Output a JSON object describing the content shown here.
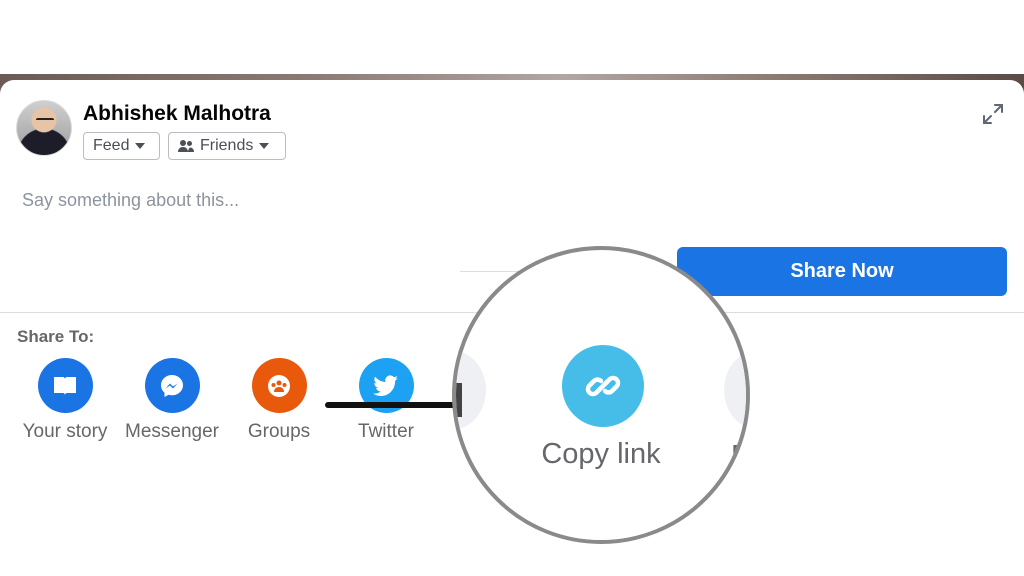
{
  "post": {
    "user_name": "Abhishek Malhotra",
    "audience_feed": "Feed",
    "audience_friends": "Friends",
    "composer_placeholder": "Say something about this...",
    "share_now_label": "Share Now"
  },
  "share_to": {
    "heading": "Share To:",
    "targets": [
      {
        "label": "Your story",
        "color": "#1b74e4",
        "icon": "book-icon"
      },
      {
        "label": "Messenger",
        "color": "#1b74e4",
        "icon": "messenger-icon"
      },
      {
        "label": "Groups",
        "color": "#e8590c",
        "icon": "groups-icon"
      },
      {
        "label": "Twitter",
        "color": "#1da1f2",
        "icon": "twitter-icon"
      }
    ]
  },
  "magnified": {
    "copy_link_label": "Copy link",
    "copy_link_color": "#45bde8",
    "edge_letter": "M"
  },
  "colors": {
    "primary": "#1b74e4",
    "text_secondary": "#65676b",
    "placeholder": "#8d949e"
  }
}
